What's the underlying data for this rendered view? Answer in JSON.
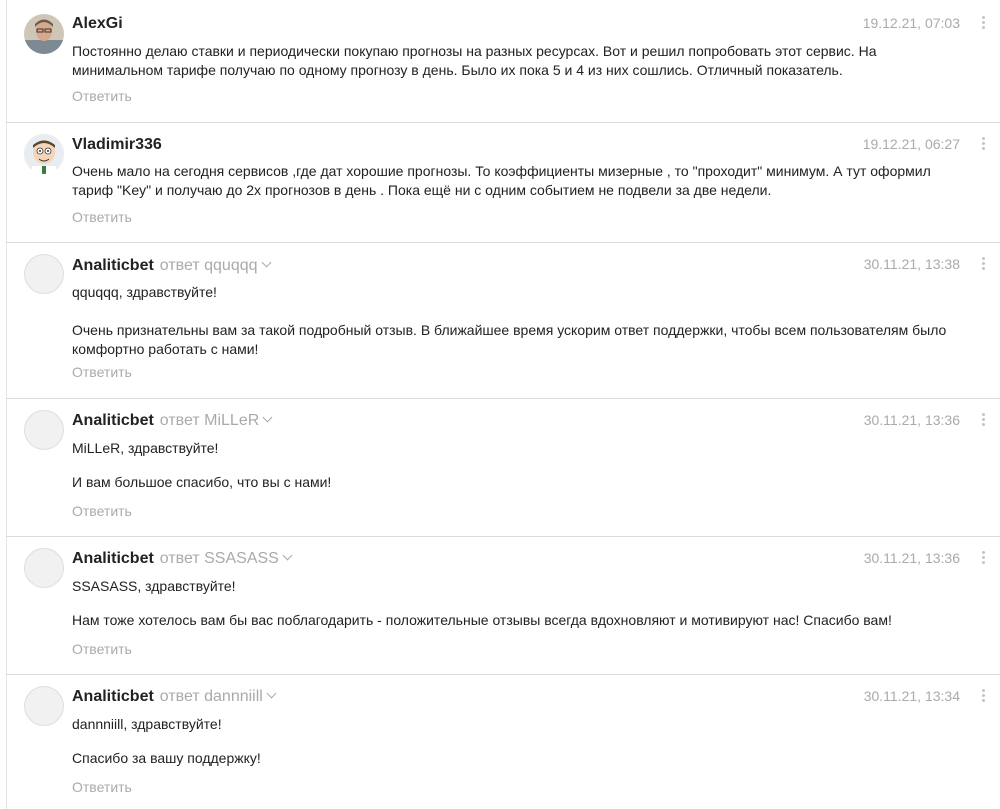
{
  "comments": [
    {
      "author": "AlexGi",
      "reply_to": "",
      "date": "19.12.21, 07:03",
      "avatar": "photo-avatar-man",
      "paragraphs": [
        "Постоянно делаю ставки и периодически покупаю прогнозы на разных ресурсах. Вот и решил попробовать этот сервис. На минимальном тарифе получаю по одному прогнозу в день. Было их пока 5 и 4 из них сошлись. Отличный показатель."
      ],
      "reply_label": "Ответить"
    },
    {
      "author": "Vladimir336",
      "reply_to": "",
      "date": "19.12.21, 06:27",
      "avatar": "cartoon-avatar",
      "paragraphs": [
        "Очень мало на сегодня сервисов ,где дат хорошие прогнозы. То коэффициенты мизерные , то \"проходит\" минимум. А тут оформил тариф \"Key\" и получаю до 2х прогнозов в день . Пока ещё ни с одним событием не подвели за две недели."
      ],
      "reply_label": "Ответить"
    },
    {
      "author": "Analiticbet",
      "reply_to": "ответ qquqqq",
      "date": "30.11.21, 13:38",
      "avatar": "default-avatar",
      "paragraphs": [
        "qquqqq, здравствуйте!",
        "Очень признательны вам за такой подробный отзыв. В ближайшее время ускорим ответ поддержки, чтобы всем пользователям было комфортно работать с нами!"
      ],
      "reply_label": "Ответить"
    },
    {
      "author": "Analiticbet",
      "reply_to": "ответ MiLLeR",
      "date": "30.11.21, 13:36",
      "avatar": "default-avatar",
      "paragraphs": [
        "MiLLeR, здравствуйте!",
        "И вам большое спасибо, что вы с нами!"
      ],
      "reply_label": "Ответить"
    },
    {
      "author": "Analiticbet",
      "reply_to": "ответ SSASASS",
      "date": "30.11.21, 13:36",
      "avatar": "default-avatar",
      "paragraphs": [
        "SSASASS, здравствуйте!",
        "Нам тоже хотелось вам бы вас поблагодарить - положительные отзывы всегда вдохновляют и мотивируют нас! Спасибо вам!"
      ],
      "reply_label": "Ответить"
    },
    {
      "author": "Analiticbet",
      "reply_to": "ответ dannniill",
      "date": "30.11.21, 13:34",
      "avatar": "default-avatar",
      "paragraphs": [
        "dannniill, здравствуйте!",
        "Спасибо за вашу поддержку!"
      ],
      "reply_label": "Ответить"
    }
  ]
}
